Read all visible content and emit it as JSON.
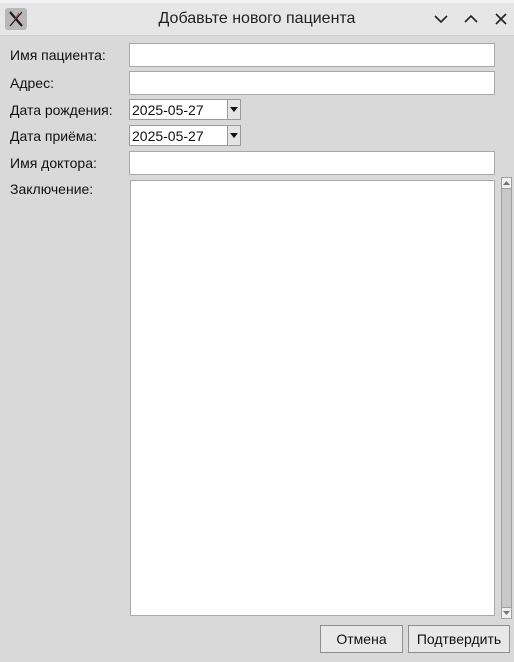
{
  "window": {
    "title": "Добавьте нового пациента",
    "icon": "x-app-icon",
    "controls": [
      "minimize-icon",
      "maximize-icon",
      "close-icon"
    ]
  },
  "form": {
    "patient_name_label": "Имя пациента:",
    "patient_name_value": "",
    "address_label": "Адрес:",
    "address_value": "",
    "birth_date_label": "Дата рождения:",
    "birth_date_value": "2025-05-27",
    "appointment_date_label": "Дата приёма:",
    "appointment_date_value": "2025-05-27",
    "doctor_name_label": "Имя доктора:",
    "doctor_name_value": "",
    "conclusion_label": "Заключение:",
    "conclusion_value": ""
  },
  "buttons": {
    "cancel": "Отмена",
    "confirm": "Подтвердить"
  }
}
